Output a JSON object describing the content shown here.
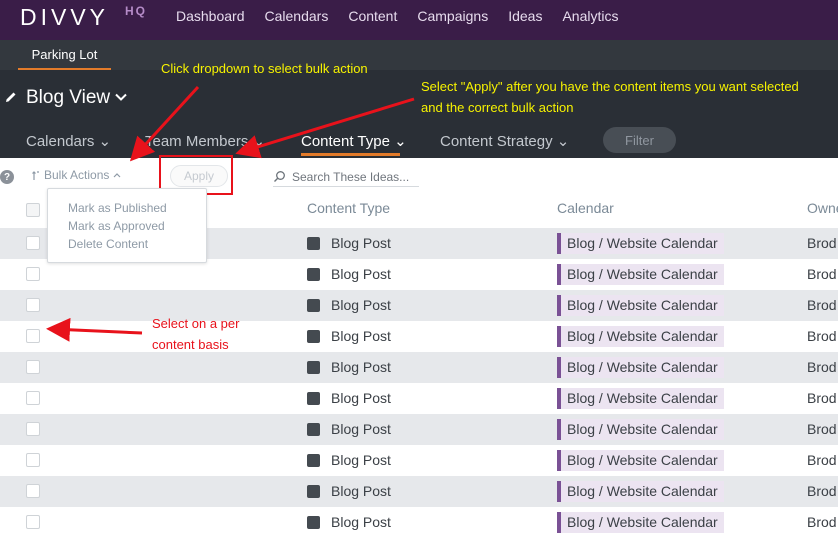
{
  "app": {
    "logo": "DIVVY",
    "logo_suffix": "HQ",
    "nav": [
      "Dashboard",
      "Calendars",
      "Content",
      "Campaigns",
      "Ideas",
      "Analytics"
    ]
  },
  "subnav": {
    "active_tab": "Parking Lot"
  },
  "header": {
    "title": "Blog View",
    "filters": [
      {
        "label": "Calendars",
        "active": false
      },
      {
        "label": "Team Members",
        "active": false
      },
      {
        "label": "Content Type",
        "active": true
      },
      {
        "label": "Content Strategy",
        "active": false
      }
    ],
    "filter_button": "Filter"
  },
  "toolbar": {
    "bulk_actions_label": "Bulk Actions",
    "apply_label": "Apply",
    "search_placeholder": "Search These Ideas..."
  },
  "bulk_menu": [
    "Mark as Published",
    "Mark as Approved",
    "Delete Content"
  ],
  "table": {
    "columns": [
      "Content Type",
      "Calendar",
      "Owne"
    ],
    "rows": [
      {
        "type": "Blog Post",
        "calendar": "Blog / Website Calendar",
        "owner": "Brod"
      },
      {
        "type": "Blog Post",
        "calendar": "Blog / Website Calendar",
        "owner": "Brod"
      },
      {
        "type": "Blog Post",
        "calendar": "Blog / Website Calendar",
        "owner": "Brod"
      },
      {
        "type": "Blog Post",
        "calendar": "Blog / Website Calendar",
        "owner": "Brod"
      },
      {
        "type": "Blog Post",
        "calendar": "Blog / Website Calendar",
        "owner": "Brod"
      },
      {
        "type": "Blog Post",
        "calendar": "Blog / Website Calendar",
        "owner": "Brod"
      },
      {
        "type": "Blog Post",
        "calendar": "Blog / Website Calendar",
        "owner": "Brod"
      },
      {
        "type": "Blog Post",
        "calendar": "Blog / Website Calendar",
        "owner": "Brod"
      },
      {
        "type": "Blog Post",
        "calendar": "Blog / Website Calendar",
        "owner": "Brod"
      },
      {
        "type": "Blog Post",
        "calendar": "Blog / Website Calendar",
        "owner": "Brod"
      }
    ]
  },
  "annotations": {
    "dropdown_hint": "Click dropdown to select bulk action",
    "apply_hint_line1": "Select \"Apply\" after you have the content items you want selected",
    "apply_hint_line2": "and the correct bulk action",
    "select_hint_line1": "Select on a per",
    "select_hint_line2": "content basis"
  },
  "colors": {
    "nav_bg": "#3a1d48",
    "header_bg": "#2a2f36",
    "accent": "#e37b2a",
    "calendar_tag": "#7a5195",
    "annotation_yellow": "#f7f300",
    "annotation_red": "#e8121b"
  },
  "icons": {
    "edit": "pencil-icon",
    "help": "help-icon",
    "sort": "sort-icon",
    "search": "search-icon",
    "content_type": "rss-icon"
  }
}
